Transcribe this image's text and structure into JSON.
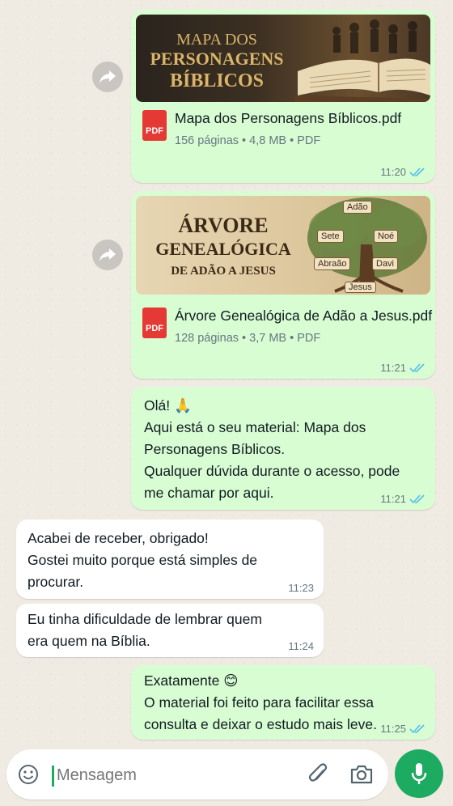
{
  "messages": [
    {
      "thumb_title_lines": [
        "MAPA DOS",
        "PERSONAGENS",
        "BÍBLICOS"
      ],
      "file_name": "Mapa dos Personagens Bíblicos.pdf",
      "pdf_label": "PDF",
      "meta": "156 páginas • 4,8 MB • PDF",
      "time": "11:20"
    },
    {
      "thumb_title_lines": [
        "ÁRVORE",
        "GENEALÓGICA",
        "DE ADÃO A JESUS"
      ],
      "tree_labels": [
        "Adão",
        "Sete",
        "Noé",
        "Abraão",
        "Davi",
        "Jesus"
      ],
      "file_name": "Árvore Genealógica de Adão a Jesus.pdf",
      "pdf_label": "PDF",
      "meta": "128 páginas • 3,7 MB • PDF",
      "time": "11:21"
    },
    {
      "lines": [
        "Olá! 🙏",
        "Aqui está o seu material: Mapa dos",
        "Personagens Bíblicos.",
        "Qualquer dúvida durante o acesso, pode",
        "me chamar por aqui."
      ],
      "time": "11:21"
    },
    {
      "lines": [
        "Acabei de receber, obrigado!",
        "Gostei muito porque está simples de",
        "procurar."
      ],
      "time": "11:23"
    },
    {
      "lines": [
        "Eu tinha dificuldade de lembrar quem",
        "era quem na Bíblia."
      ],
      "time": "11:24"
    },
    {
      "lines": [
        "Exatamente 😊",
        "O material foi feito para facilitar essa",
        "consulta e deixar o estudo mais leve."
      ],
      "time": "11:25"
    }
  ],
  "input": {
    "placeholder": "Mensagem"
  },
  "icons": {
    "forward": "forward-arrow-icon",
    "emoji": "emoji-icon",
    "attach": "paperclip-icon",
    "camera": "camera-icon",
    "mic": "microphone-icon",
    "read": "double-check-icon"
  },
  "colors": {
    "outgoing": "#d9fdd3",
    "incoming": "#ffffff",
    "accent": "#1daa61",
    "read_ticks": "#53bdeb"
  }
}
